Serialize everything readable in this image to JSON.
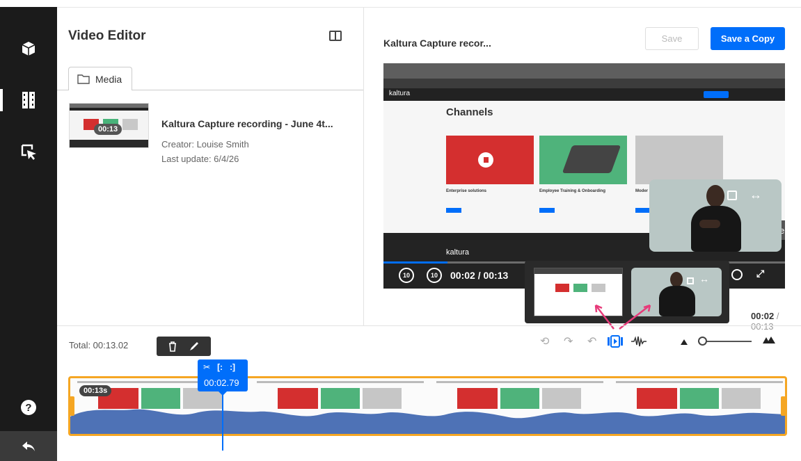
{
  "rail": {
    "items": [
      {
        "name": "media-icon"
      },
      {
        "name": "editor-icon"
      },
      {
        "name": "interactivity-icon"
      }
    ],
    "help": "?",
    "back": "back-icon"
  },
  "left": {
    "title": "Video Editor",
    "tab": "Media",
    "media": {
      "title": "Kaltura Capture recording - June 4t...",
      "duration": "00:13",
      "creator": "Creator: Louise Smith",
      "updated": "Last update: 6/4/26"
    }
  },
  "right": {
    "title": "Kaltura Capture recor...",
    "save": "Save",
    "save_copy": "Save a Copy",
    "player": {
      "page_heading": "Channels",
      "logo": "kaltura",
      "cards": [
        "Enterprise solutions",
        "Employee Training & Onboarding",
        "Moder"
      ],
      "time": "00:02 / 00:13",
      "rewind": "10",
      "forward": "10",
      "hide": "Hide",
      "progress": 0.16
    },
    "current": "00:02",
    "total": "00:13"
  },
  "timeline": {
    "total": "Total: 00:13.02",
    "clip_duration": "00:13s",
    "playhead": "00:02.79",
    "zoom": 0.05
  }
}
